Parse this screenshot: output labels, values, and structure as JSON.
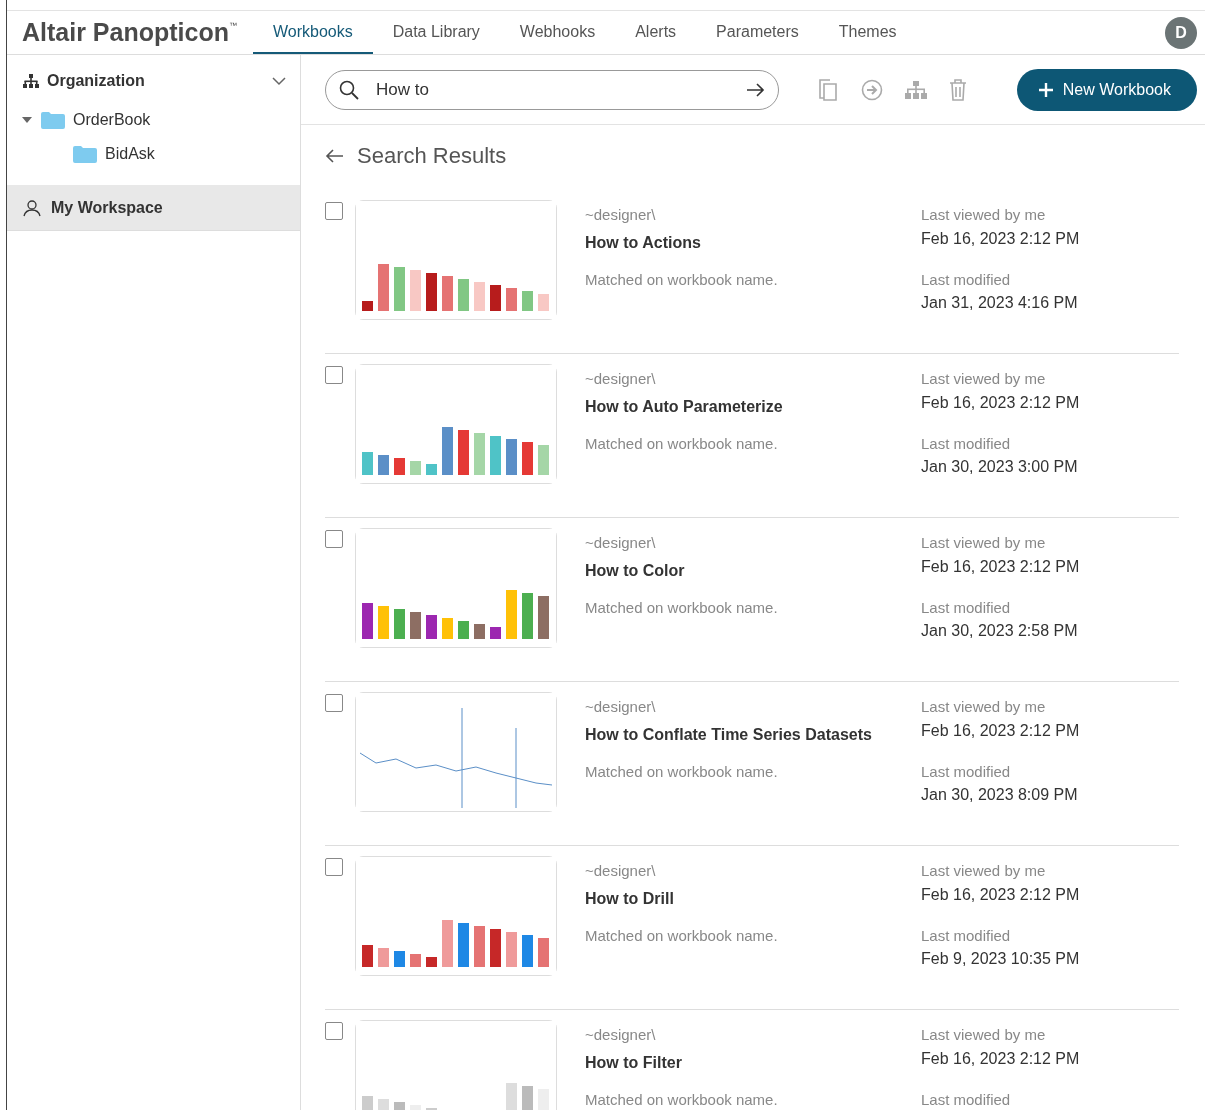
{
  "app": {
    "logo": "Altair Panopticon",
    "trademark": "™",
    "avatar": "D"
  },
  "tabs": [
    {
      "label": "Workbooks",
      "selected": true
    },
    {
      "label": "Data Library",
      "selected": false
    },
    {
      "label": "Webhooks",
      "selected": false
    },
    {
      "label": "Alerts",
      "selected": false
    },
    {
      "label": "Parameters",
      "selected": false
    },
    {
      "label": "Themes",
      "selected": false
    }
  ],
  "sidebar": {
    "section": {
      "label": "Organization",
      "expanded": true
    },
    "tree": [
      {
        "label": "OrderBook",
        "expanded": true,
        "children": [
          {
            "label": "BidAsk"
          }
        ]
      }
    ],
    "items": [
      {
        "label": "My Workspace",
        "selected": true
      }
    ]
  },
  "search": {
    "value": "How to"
  },
  "new_button": {
    "label": "New Workbook"
  },
  "results_title": "Search Results",
  "results": [
    {
      "checked": false,
      "path": "~designer\\",
      "name": "How to Actions",
      "match": "Matched on workbook name.",
      "viewed_label": "Last viewed by me",
      "viewed": "Feb 16, 2023 2:12 PM",
      "modified_label": "Last modified",
      "modified": "Jan 31, 2023 4:16 PM"
    },
    {
      "checked": false,
      "path": "~designer\\",
      "name": "How to Auto Parameterize",
      "match": "Matched on workbook name.",
      "viewed_label": "Last viewed by me",
      "viewed": "Feb 16, 2023 2:12 PM",
      "modified_label": "Last modified",
      "modified": "Jan 30, 2023 3:00 PM"
    },
    {
      "checked": false,
      "path": "~designer\\",
      "name": "How to Color",
      "match": "Matched on workbook name.",
      "viewed_label": "Last viewed by me",
      "viewed": "Feb 16, 2023 2:12 PM",
      "modified_label": "Last modified",
      "modified": "Jan 30, 2023 2:58 PM"
    },
    {
      "checked": false,
      "path": "~designer\\",
      "name": "How to Conflate Time Series Datasets",
      "match": "Matched on workbook name.",
      "viewed_label": "Last viewed by me",
      "viewed": "Feb 16, 2023 2:12 PM",
      "modified_label": "Last modified",
      "modified": "Jan 30, 2023 8:09 PM"
    },
    {
      "checked": false,
      "path": "~designer\\",
      "name": "How to Drill",
      "match": "Matched on workbook name.",
      "viewed_label": "Last viewed by me",
      "viewed": "Feb 16, 2023 2:12 PM",
      "modified_label": "Last modified",
      "modified": "Feb 9, 2023 10:35 PM"
    },
    {
      "checked": false,
      "path": "~designer\\",
      "name": "How to Filter",
      "match": "Matched on workbook name.",
      "viewed_label": "Last viewed by me",
      "viewed": "Feb 16, 2023 2:12 PM",
      "modified_label": "Last modified"
    }
  ]
}
